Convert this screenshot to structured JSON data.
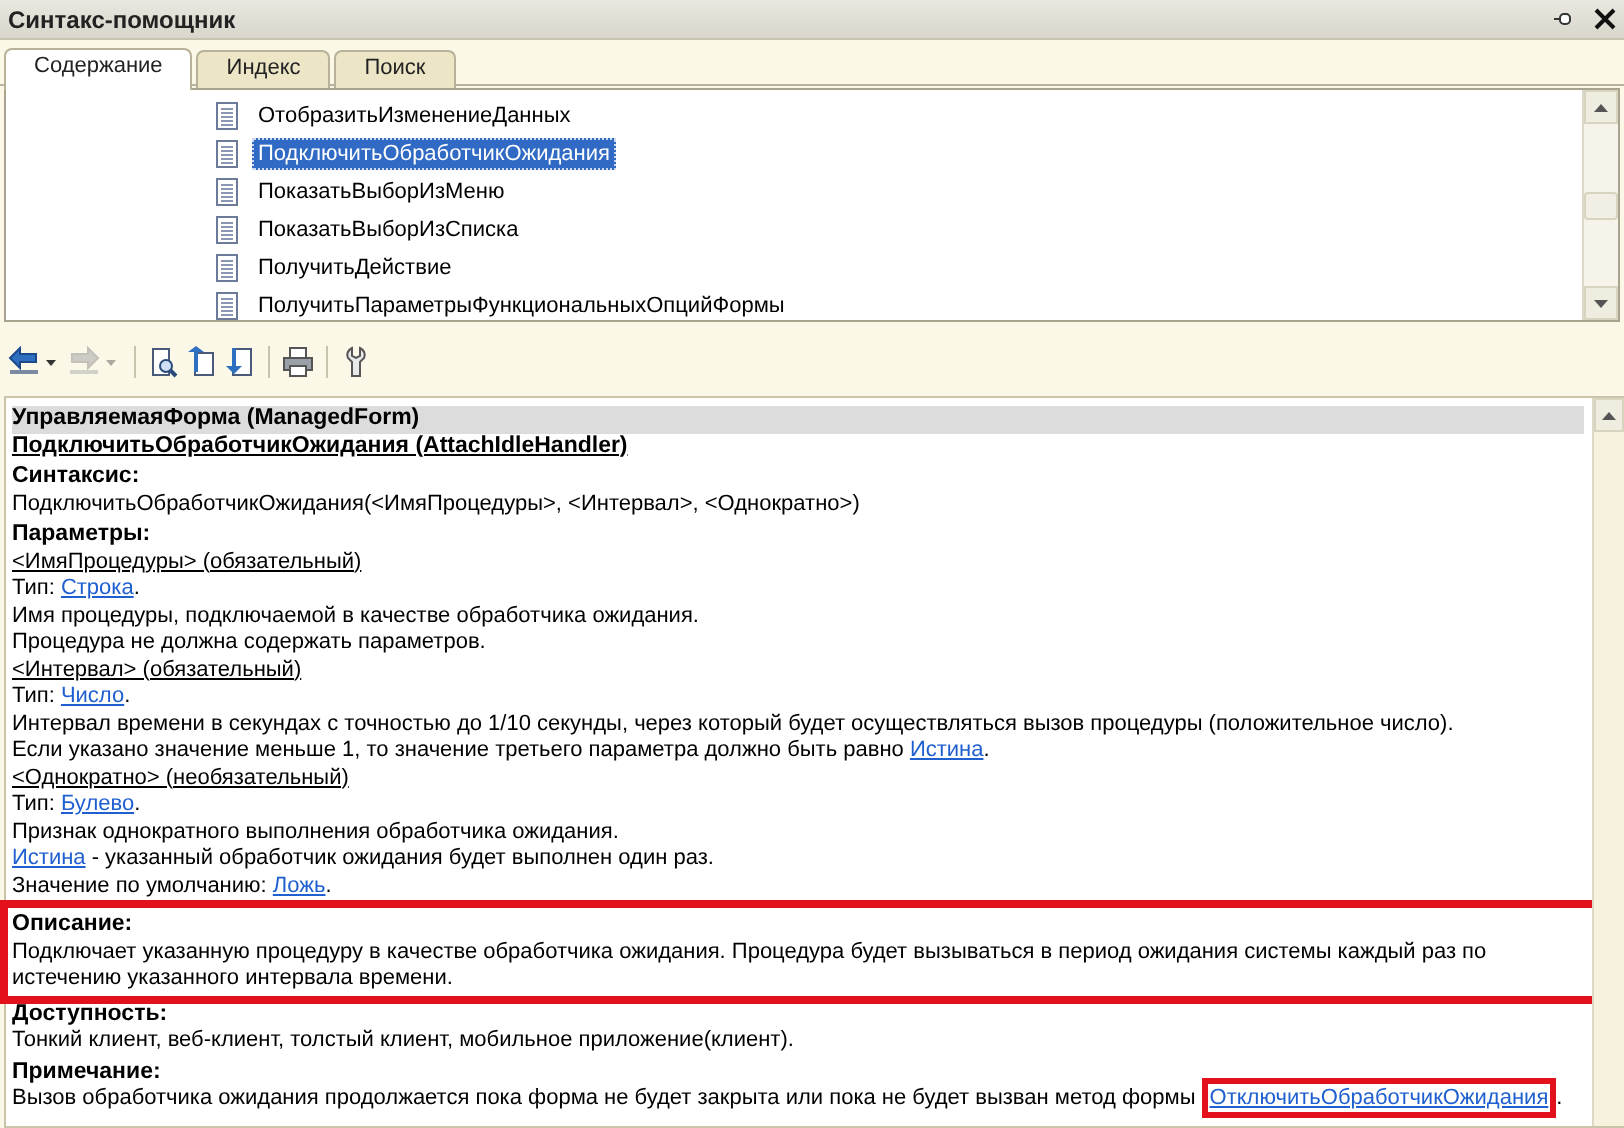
{
  "window": {
    "title": "Синтакс-помощник"
  },
  "tabs": [
    {
      "label": "Содержание",
      "selected": true
    },
    {
      "label": "Индекс",
      "selected": false
    },
    {
      "label": "Поиск",
      "selected": false
    }
  ],
  "tree": {
    "items": [
      {
        "label": "ОтобразитьИзменениеДанных",
        "selected": false
      },
      {
        "label": "ПодключитьОбработчикОжидания",
        "selected": true
      },
      {
        "label": "ПоказатьВыборИзМеню",
        "selected": false
      },
      {
        "label": "ПоказатьВыборИзСписка",
        "selected": false
      },
      {
        "label": "ПолучитьДействие",
        "selected": false
      },
      {
        "label": "ПолучитьПараметрыФункциональныхОпцийФормы",
        "selected": false
      }
    ]
  },
  "toolbar": {
    "groups": [
      {
        "buttons": [
          {
            "kind": "back",
            "disabled": false
          },
          {
            "kind": "forward",
            "disabled": true
          }
        ]
      },
      {
        "buttons": [
          {
            "kind": "find",
            "disabled": false
          },
          {
            "kind": "up",
            "disabled": false
          },
          {
            "kind": "down",
            "disabled": false
          }
        ]
      },
      {
        "buttons": [
          {
            "kind": "print",
            "disabled": false
          }
        ]
      },
      {
        "buttons": [
          {
            "kind": "tools",
            "disabled": false
          }
        ]
      }
    ]
  },
  "article": {
    "header": "УправляемаяФорма (ManagedForm)",
    "title": "ПодключитьОбработчикОжидания (AttachIdleHandler)",
    "sections": [
      {
        "heading": "Синтаксис:",
        "highlighted": false,
        "lines": [
          {
            "kind": "text",
            "parts": [
              {
                "kind": "text",
                "text": "ПодключитьОбработчикОжидания(<ИмяПроцедуры>, <Интервал>, <Однократно>)"
              }
            ]
          }
        ]
      },
      {
        "heading": "Параметры:",
        "highlighted": false,
        "lines": [
          {
            "kind": "param",
            "parts": [
              {
                "kind": "text",
                "text": "<ИмяПроцедуры> (обязательный)"
              }
            ]
          },
          {
            "kind": "text",
            "parts": [
              {
                "kind": "text",
                "text": "Тип: "
              },
              {
                "kind": "link",
                "text": "Строка",
                "highlighted": false
              },
              {
                "kind": "text",
                "text": "."
              }
            ]
          },
          {
            "kind": "text",
            "parts": [
              {
                "kind": "text",
                "text": "Имя процедуры, подключаемой в качестве обработчика ожидания."
              }
            ]
          },
          {
            "kind": "text",
            "parts": [
              {
                "kind": "text",
                "text": "Процедура не должна содержать параметров."
              }
            ]
          },
          {
            "kind": "param",
            "parts": [
              {
                "kind": "text",
                "text": "<Интервал> (обязательный)"
              }
            ]
          },
          {
            "kind": "text",
            "parts": [
              {
                "kind": "text",
                "text": "Тип: "
              },
              {
                "kind": "link",
                "text": "Число",
                "highlighted": false
              },
              {
                "kind": "text",
                "text": "."
              }
            ]
          },
          {
            "kind": "text",
            "parts": [
              {
                "kind": "text",
                "text": "Интервал времени в секундах с точностью до 1/10 секунды, через который будет осуществляться вызов процедуры (положительное число)."
              }
            ]
          },
          {
            "kind": "text",
            "parts": [
              {
                "kind": "text",
                "text": "Если указано значение меньше 1, то значение третьего параметра должно быть равно "
              },
              {
                "kind": "link",
                "text": "Истина",
                "highlighted": false
              },
              {
                "kind": "text",
                "text": "."
              }
            ]
          },
          {
            "kind": "param",
            "parts": [
              {
                "kind": "text",
                "text": "<Однократно> (необязательный)"
              }
            ]
          },
          {
            "kind": "text",
            "parts": [
              {
                "kind": "text",
                "text": "Тип: "
              },
              {
                "kind": "link",
                "text": "Булево",
                "highlighted": false
              },
              {
                "kind": "text",
                "text": "."
              }
            ]
          },
          {
            "kind": "text",
            "parts": [
              {
                "kind": "text",
                "text": "Признак однократного выполнения обработчика ожидания."
              }
            ]
          },
          {
            "kind": "text",
            "parts": [
              {
                "kind": "link",
                "text": "Истина",
                "highlighted": false
              },
              {
                "kind": "text",
                "text": " - указанный обработчик ожидания будет выполнен один раз."
              }
            ]
          },
          {
            "kind": "text",
            "parts": [
              {
                "kind": "text",
                "text": "Значение по умолчанию: "
              },
              {
                "kind": "link",
                "text": "Ложь",
                "highlighted": false
              },
              {
                "kind": "text",
                "text": "."
              }
            ]
          }
        ]
      },
      {
        "heading": "Описание:",
        "highlighted": true,
        "lines": [
          {
            "kind": "text",
            "parts": [
              {
                "kind": "text",
                "text": "Подключает указанную процедуру в качестве обработчика ожидания. Процедура будет вызываться в период ожидания системы каждый раз по истечению указанного интервала времени."
              }
            ]
          }
        ]
      },
      {
        "heading": "Доступность:",
        "highlighted": false,
        "lines": [
          {
            "kind": "text",
            "parts": [
              {
                "kind": "text",
                "text": "Тонкий клиент, веб-клиент, толстый клиент, мобильное приложение(клиент)."
              }
            ]
          }
        ]
      },
      {
        "heading": "Примечание:",
        "highlighted": false,
        "lines": [
          {
            "kind": "text",
            "parts": [
              {
                "kind": "text",
                "text": "Вызов обработчика ожидания продолжается пока форма не будет закрыта или пока не будет вызван метод формы "
              },
              {
                "kind": "link",
                "text": "ОтключитьОбработчикОжидания",
                "highlighted": true
              },
              {
                "kind": "text",
                "text": "."
              }
            ]
          }
        ]
      }
    ]
  }
}
